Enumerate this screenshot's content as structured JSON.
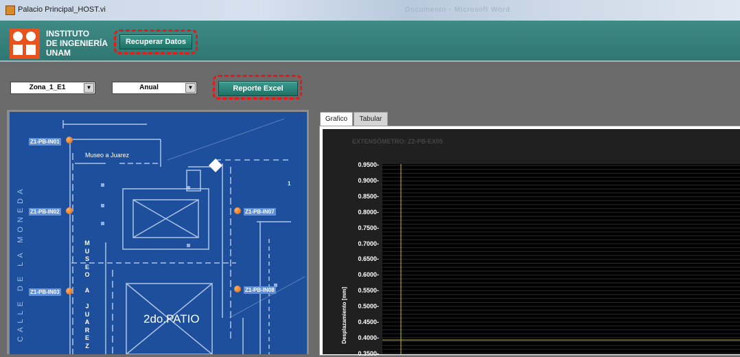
{
  "window": {
    "title": "Palacio Principal_HOST.vi",
    "blurred_title": "Documento - Microsoft Word"
  },
  "header": {
    "institution_lines": [
      "INSTITUTO",
      "DE INGENIERÍA",
      "UNAM"
    ],
    "recover_button": "Recuperar Datos"
  },
  "controls": {
    "zone_select": "Zona_1_E1",
    "period_select": "Anual",
    "report_button": "Reporte Excel"
  },
  "map": {
    "street_label": "CALLE DE LA MONEDA",
    "museum_label": "Museo a Juarez",
    "museum_vertical": [
      "M",
      "U",
      "S",
      "E",
      "O",
      "",
      "A",
      "",
      "J",
      "U",
      "A",
      "R",
      "E",
      "Z"
    ],
    "patio_label": "2do.PATIO",
    "edge_mark": "1",
    "sensors": [
      "Z1-PB-IN01",
      "Z1-PB-IN02",
      "Z1-PB-IN03",
      "Z1-PB-IN07",
      "Z1-PB-IN08"
    ]
  },
  "tabs": [
    "Grafico",
    "Tabular"
  ],
  "graph": {
    "title": "EXTENSÓMETRO: Z2-PB-EX05",
    "ylabel": "Desplazamiento [mm]",
    "yticks": [
      "0.9500",
      "0.9000",
      "0.8500",
      "0.8000",
      "0.7500",
      "0.7000",
      "0.6500",
      "0.6000",
      "0.5500",
      "0.5000",
      "0.4500",
      "0.4000",
      "0.3500"
    ],
    "cursor_y": 0.395,
    "colors": {
      "plot_bg": "#000000",
      "cursor": "#c8c800",
      "grid": "#2a2a2a"
    }
  }
}
